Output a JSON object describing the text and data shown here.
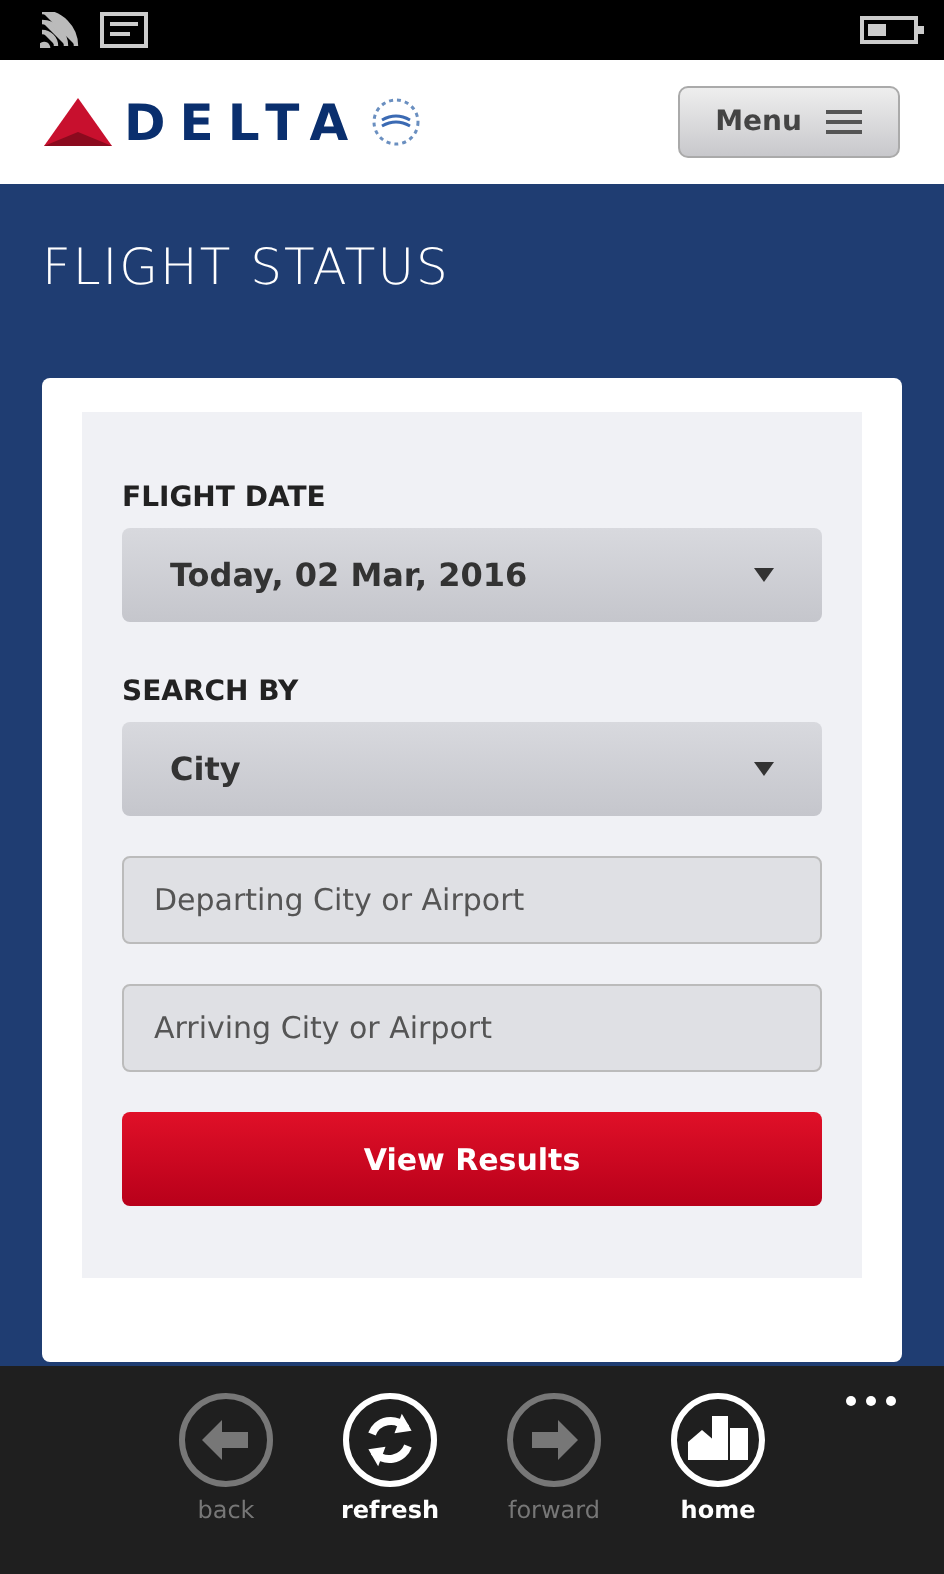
{
  "header": {
    "logo": "DELTA",
    "menu_button": "Menu"
  },
  "page_title": "FLIGHT STATUS",
  "form": {
    "flight_date": {
      "label": "FLIGHT DATE",
      "value": "Today, 02 Mar, 2016"
    },
    "search_by": {
      "label": "SEARCH BY",
      "value": "City"
    },
    "departing": {
      "placeholder": "Departing City or Airport"
    },
    "arriving": {
      "placeholder": "Arriving City or Airport"
    },
    "submit": "View Results"
  },
  "app_bar": [
    {
      "kind": "back",
      "label": "back",
      "disabled": true
    },
    {
      "kind": "refresh",
      "label": "refresh",
      "disabled": false
    },
    {
      "kind": "forward",
      "label": "forward",
      "disabled": true
    },
    {
      "kind": "home",
      "label": "home",
      "disabled": false
    }
  ]
}
